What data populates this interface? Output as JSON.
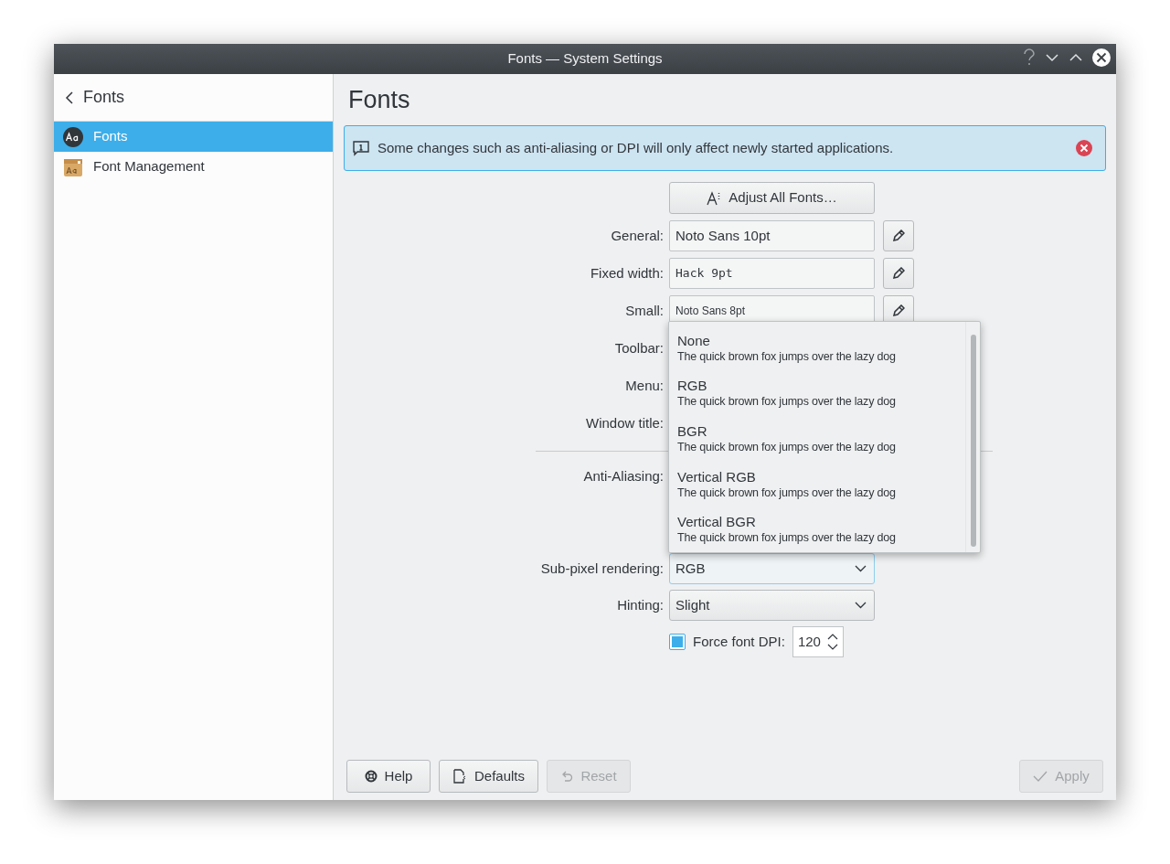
{
  "window": {
    "title": "Fonts — System Settings"
  },
  "sidebar": {
    "back_label": "Fonts",
    "items": [
      {
        "label": "Fonts",
        "kind": "fonts",
        "selected": true
      },
      {
        "label": "Font Management",
        "kind": "management",
        "selected": false
      }
    ]
  },
  "page": {
    "title": "Fonts",
    "message": "Some changes such as anti-aliasing or DPI will only affect newly started applications."
  },
  "adjust_button": "Adjust All Fonts…",
  "font_rows": [
    {
      "label": "General:",
      "value": "Noto Sans 10pt",
      "kind": "proportional"
    },
    {
      "label": "Fixed width:",
      "value": "Hack 9pt",
      "kind": "monospace"
    },
    {
      "label": "Small:",
      "value": "Noto Sans 8pt",
      "kind": "small"
    },
    {
      "label": "Toolbar:",
      "kind": "covered"
    },
    {
      "label": "Menu:",
      "kind": "covered"
    },
    {
      "label": "Window title:",
      "kind": "covered"
    }
  ],
  "anti_aliasing": {
    "label": "Anti-Aliasing:"
  },
  "subpixel": {
    "label": "Sub-pixel rendering:",
    "value": "RGB"
  },
  "hinting": {
    "label": "Hinting:",
    "value": "Slight"
  },
  "force_dpi": {
    "label": "Force font DPI:",
    "checked": true,
    "value": "120"
  },
  "popup": {
    "options": [
      {
        "label": "None",
        "sample": "The quick brown fox jumps over the lazy dog"
      },
      {
        "label": "RGB",
        "sample": "The quick brown fox jumps over the lazy dog"
      },
      {
        "label": "BGR",
        "sample": "The quick brown fox jumps over the lazy dog"
      },
      {
        "label": "Vertical RGB",
        "sample": "The quick brown fox jumps over the lazy dog"
      },
      {
        "label": "Vertical BGR",
        "sample": "The quick brown fox jumps over the lazy dog"
      }
    ]
  },
  "buttons": [
    {
      "label": "Help",
      "kind": "help",
      "disabled": false
    },
    {
      "label": "Defaults",
      "kind": "defaults",
      "disabled": false
    },
    {
      "label": "Reset",
      "kind": "reset",
      "disabled": true
    },
    {
      "label": "Apply",
      "kind": "apply",
      "disabled": true
    }
  ]
}
